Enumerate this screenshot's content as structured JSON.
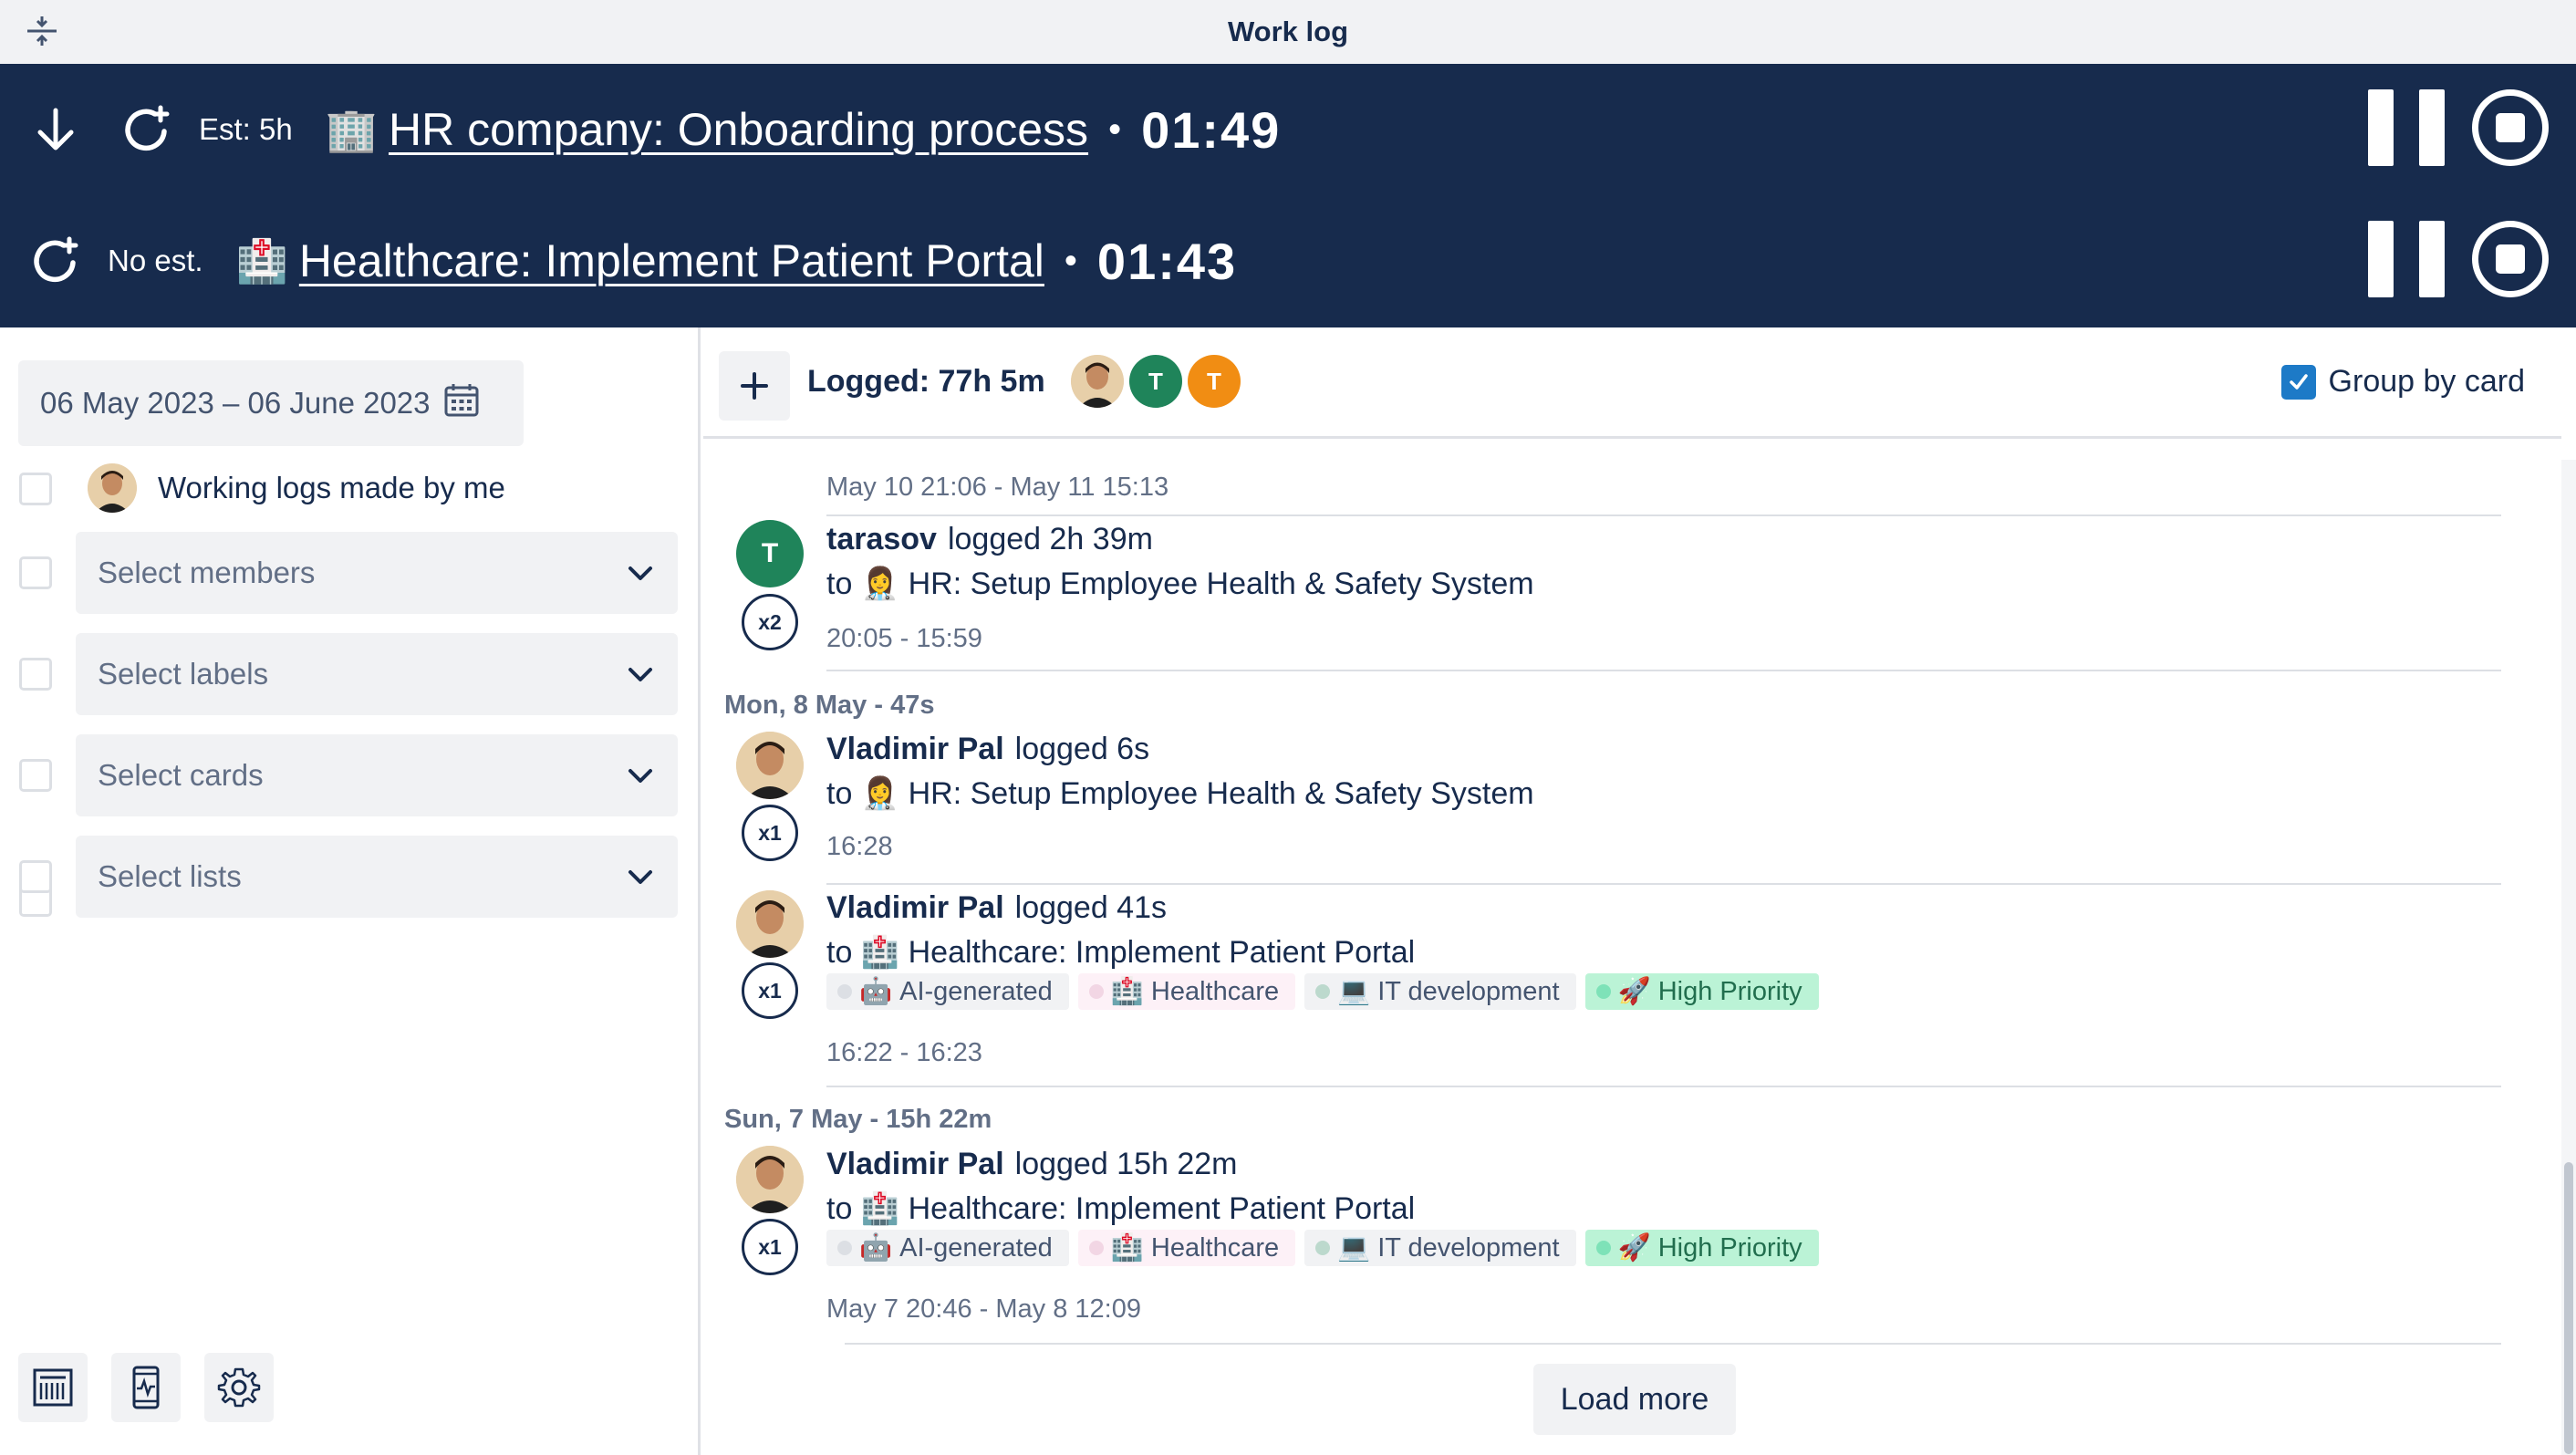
{
  "window": {
    "title": "Work log"
  },
  "timers": [
    {
      "estimate": "Est: 5h",
      "task_emoji": "🏢",
      "task": "HR company: Onboarding process",
      "elapsed": "01:49"
    },
    {
      "estimate": "No est.",
      "task_emoji": "🏥",
      "task": "Healthcare: Implement Patient Portal",
      "elapsed": "01:43"
    }
  ],
  "filters": {
    "date_range": "06 May 2023 – 06 June 2023",
    "mine_label": "Working logs made by me",
    "selects": [
      {
        "placeholder": "Select members"
      },
      {
        "placeholder": "Select labels"
      },
      {
        "placeholder": "Select cards"
      },
      {
        "placeholder": "Select lists"
      }
    ]
  },
  "toolbar": {
    "logged_total": "Logged: 77h 5m",
    "avatars": [
      {
        "type": "photo"
      },
      {
        "initial": "T",
        "color": "#1f845a"
      },
      {
        "initial": "T",
        "color": "#f18d13"
      }
    ],
    "group_by_label": "Group by card",
    "group_by_checked": true
  },
  "feed": {
    "first_range": "May 10 21:06 - May 11 15:13",
    "days": [
      {
        "heading": "",
        "entries": [
          {
            "user": "tarasov",
            "avatar_initial": "T",
            "action": "logged 2h 39m",
            "to_prefix": "to",
            "card_emoji": "👩‍⚕️",
            "card": "HR: Setup Employee Health & Safety System",
            "count": "x2",
            "time": "20:05 - 15:59",
            "labels": []
          }
        ]
      },
      {
        "heading": "Mon, 8 May - 47s",
        "entries": [
          {
            "user": "Vladimir Pal",
            "action": "logged 6s",
            "to_prefix": "to",
            "card_emoji": "👩‍⚕️",
            "card": "HR: Setup Employee Health & Safety System",
            "count": "x1",
            "time": "16:28",
            "labels": []
          },
          {
            "user": "Vladimir Pal",
            "action": "logged 41s",
            "to_prefix": "to",
            "card_emoji": "🏥",
            "card": "Healthcare: Implement Patient Portal",
            "count": "x1",
            "time": "16:22 - 16:23",
            "labels": [
              {
                "emoji": "🤖",
                "text": "AI-generated"
              },
              {
                "emoji": "🏥",
                "text": "Healthcare"
              },
              {
                "emoji": "💻",
                "text": "IT development"
              },
              {
                "emoji": "🚀",
                "text": "High Priority"
              }
            ]
          }
        ]
      },
      {
        "heading": "Sun, 7 May - 15h 22m",
        "entries": [
          {
            "user": "Vladimir Pal",
            "action": "logged 15h 22m",
            "to_prefix": "to",
            "card_emoji": "🏥",
            "card": "Healthcare: Implement Patient Portal",
            "count": "x1",
            "time": "May 7 20:46 - May 8 12:09",
            "labels": [
              {
                "emoji": "🤖",
                "text": "AI-generated"
              },
              {
                "emoji": "🏥",
                "text": "Healthcare"
              },
              {
                "emoji": "💻",
                "text": "IT development"
              },
              {
                "emoji": "🚀",
                "text": "High Priority"
              }
            ]
          }
        ]
      }
    ],
    "load_more": "Load more"
  },
  "icons": {
    "titlebar": "drag-handle-icon",
    "timer_row_1": [
      "arrow-down-icon",
      "restart-timer-icon",
      "pause-icon",
      "stop-icon"
    ],
    "timer_row_2": [
      "restart-timer-icon",
      "pause-icon",
      "stop-icon"
    ],
    "date_range": "calendar-icon",
    "select": "chevron-down-icon",
    "bottom_tools": [
      "report-icon",
      "activity-icon",
      "gear-icon"
    ],
    "toolbar": [
      "plus-icon",
      "checkmark-icon"
    ]
  },
  "colors": {
    "header_bg": "#172b4d",
    "accent_blue": "#1d7ac7",
    "label_high_priority_bg": "#bbf3d6",
    "avatar_green": "#1f845a",
    "avatar_orange": "#f18d13"
  }
}
